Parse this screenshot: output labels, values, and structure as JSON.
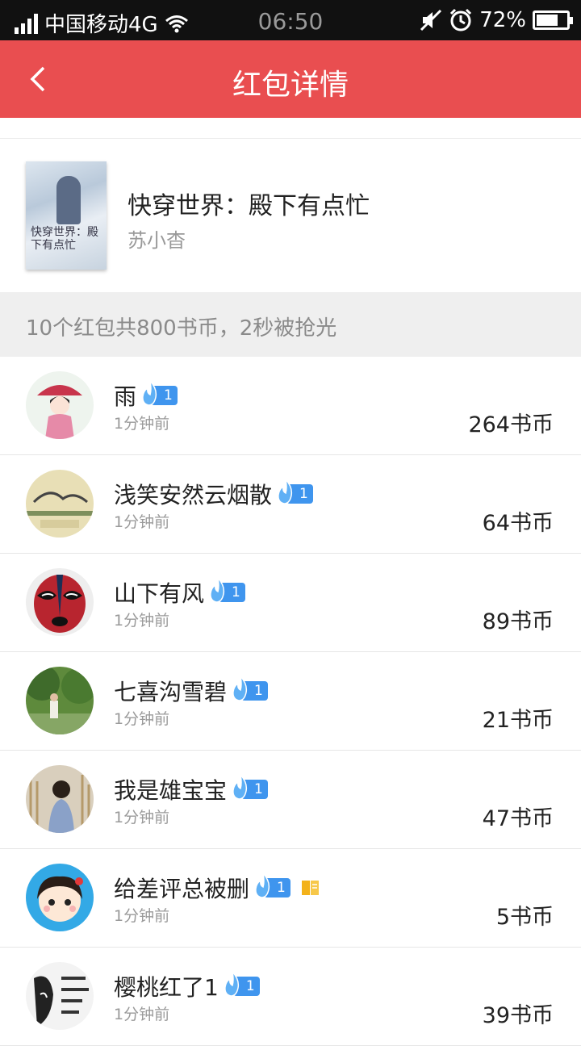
{
  "status_bar": {
    "carrier": "中国移动4G",
    "time": "06:50",
    "battery": "72%",
    "battery_level": 0.72
  },
  "header": {
    "title": "红包详情"
  },
  "book": {
    "title": "快穿世界：殿下有点忙",
    "author": "苏小杳",
    "cover_text": "快穿世界：殿下有点忙"
  },
  "summary": "10个红包共800书币，2秒被抢光",
  "recipients": [
    {
      "name": "雨",
      "level": "1",
      "time": "1分钟前",
      "amount": "264书币",
      "avatar": "girl-umbrella"
    },
    {
      "name": "浅笑安然云烟散",
      "level": "1",
      "time": "1分钟前",
      "amount": "64书币",
      "avatar": "ink-painting"
    },
    {
      "name": "山下有风",
      "level": "1",
      "time": "1分钟前",
      "amount": "89书币",
      "avatar": "opera-mask"
    },
    {
      "name": "七喜沟雪碧",
      "level": "1",
      "time": "1分钟前",
      "amount": "21书币",
      "avatar": "child-park"
    },
    {
      "name": "我是雄宝宝",
      "level": "1",
      "time": "1分钟前",
      "amount": "47书币",
      "avatar": "girl-reeds"
    },
    {
      "name": "给差评总被删",
      "level": "1",
      "time": "1分钟前",
      "amount": "5书币",
      "avatar": "cartoon-girl",
      "has_book_icon": true
    },
    {
      "name": "樱桃红了1",
      "level": "1",
      "time": "1分钟前",
      "amount": "39书币",
      "avatar": "text-portrait"
    }
  ],
  "colors": {
    "accent": "#e94e50",
    "badge": "#3f95ee"
  }
}
